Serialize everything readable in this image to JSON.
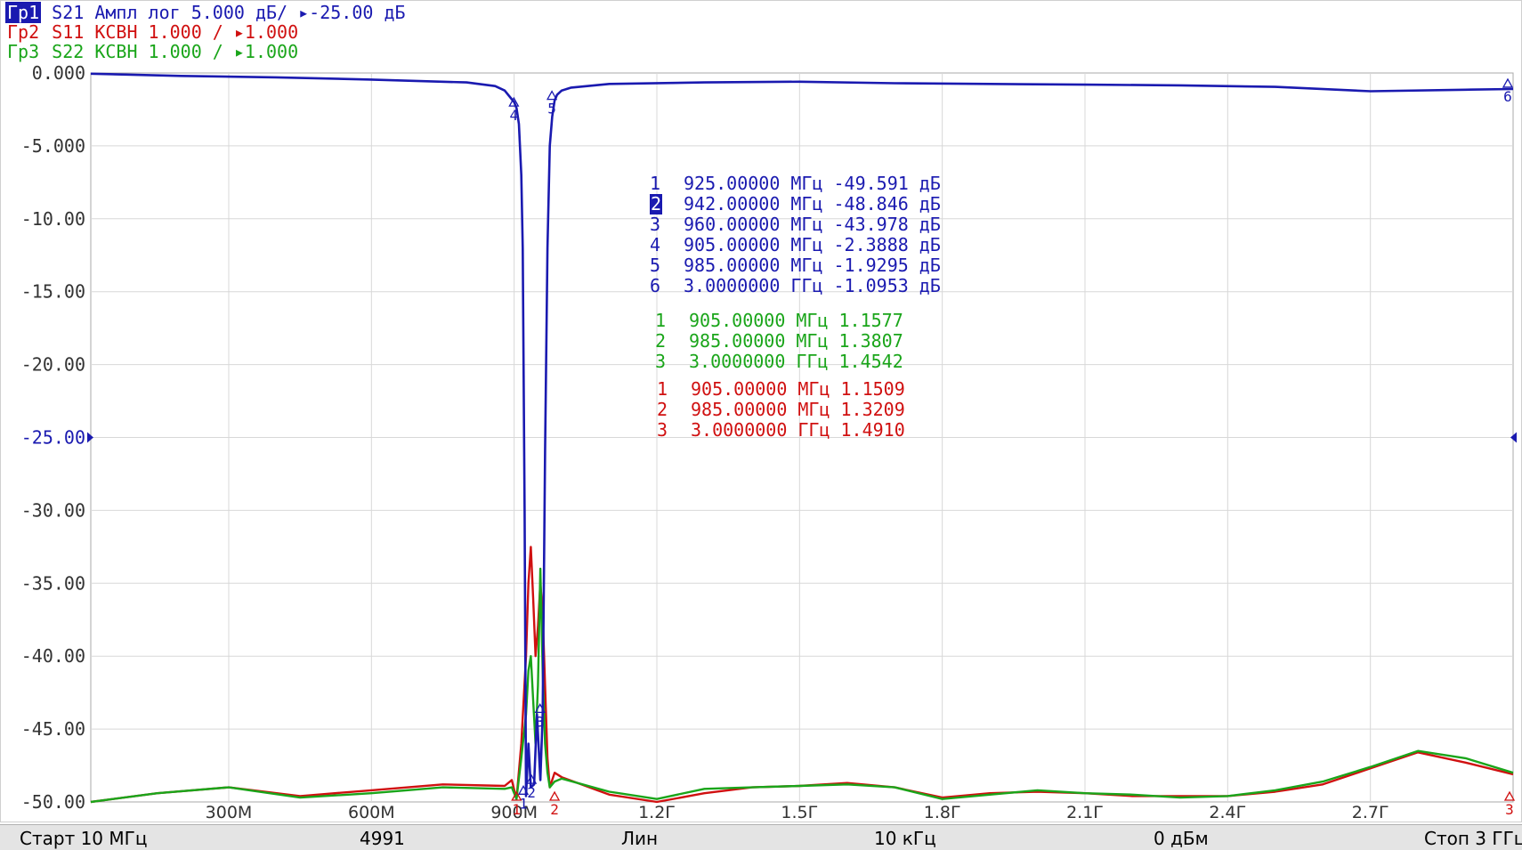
{
  "header": {
    "trace1": {
      "tag": "Гр1",
      "text": " S21 Ампл лог 5.000 дБ/ ▸-25.00 дБ"
    },
    "trace2": {
      "tag": "Гр2",
      "text": " S11 КСВН 1.000 / ▸1.000"
    },
    "trace3": {
      "tag": "Гр3",
      "text": " S22 КСВН 1.000 / ▸1.000"
    }
  },
  "colors": {
    "s21": "#1a1ab0",
    "s11": "#d01010",
    "s22": "#1aa51a",
    "grid": "#d8d8d8"
  },
  "markers": {
    "s21": [
      {
        "n": "1",
        "freq": "925.00000",
        "unit": "МГц",
        "val": "-49.591",
        "vunit": "дБ"
      },
      {
        "n": "2",
        "freq": "942.00000",
        "unit": "МГц",
        "val": "-48.846",
        "vunit": "дБ",
        "selected": true
      },
      {
        "n": "3",
        "freq": "960.00000",
        "unit": "МГц",
        "val": "-43.978",
        "vunit": "дБ"
      },
      {
        "n": "4",
        "freq": "905.00000",
        "unit": "МГц",
        "val": "-2.3888",
        "vunit": "дБ"
      },
      {
        "n": "5",
        "freq": "985.00000",
        "unit": "МГц",
        "val": "-1.9295",
        "vunit": "дБ"
      },
      {
        "n": "6",
        "freq": "3.0000000",
        "unit": "ГГц",
        "val": "-1.0953",
        "vunit": "дБ"
      }
    ],
    "s22": [
      {
        "n": "1",
        "freq": "905.00000",
        "unit": "МГц",
        "val": "1.1577",
        "vunit": ""
      },
      {
        "n": "2",
        "freq": "985.00000",
        "unit": "МГц",
        "val": "1.3807",
        "vunit": ""
      },
      {
        "n": "3",
        "freq": "3.0000000",
        "unit": "ГГц",
        "val": "1.4542",
        "vunit": ""
      }
    ],
    "s11": [
      {
        "n": "1",
        "freq": "905.00000",
        "unit": "МГц",
        "val": "1.1509",
        "vunit": ""
      },
      {
        "n": "2",
        "freq": "985.00000",
        "unit": "МГц",
        "val": "1.3209",
        "vunit": ""
      },
      {
        "n": "3",
        "freq": "3.0000000",
        "unit": "ГГц",
        "val": "1.4910",
        "vunit": ""
      }
    ]
  },
  "status": {
    "start": "Старт 10 МГц",
    "points": "4991",
    "sweep": "Лин",
    "ifbw": "10 кГц",
    "power": "0 дБм",
    "stop": "Стоп 3 ГГц"
  },
  "chart_data": {
    "type": "line",
    "title": "",
    "xlabel": "",
    "ylabel": "",
    "xlim_mhz": [
      10,
      3000
    ],
    "ylim": [
      -50,
      0
    ],
    "grid": true,
    "xticks": [
      {
        "v": 300,
        "label": "300М"
      },
      {
        "v": 600,
        "label": "600М"
      },
      {
        "v": 900,
        "label": "900М"
      },
      {
        "v": 1200,
        "label": "1.2Г"
      },
      {
        "v": 1500,
        "label": "1.5Г"
      },
      {
        "v": 1800,
        "label": "1.8Г"
      },
      {
        "v": 2100,
        "label": "2.1Г"
      },
      {
        "v": 2400,
        "label": "2.4Г"
      },
      {
        "v": 2700,
        "label": "2.7Г"
      }
    ],
    "yticks": [
      {
        "v": 0,
        "label": "0.000"
      },
      {
        "v": -5,
        "label": "-5.000"
      },
      {
        "v": -10,
        "label": "-10.00"
      },
      {
        "v": -15,
        "label": "-15.00"
      },
      {
        "v": -20,
        "label": "-20.00"
      },
      {
        "v": -25,
        "label": "-25.00"
      },
      {
        "v": -30,
        "label": "-30.00"
      },
      {
        "v": -35,
        "label": "-35.00"
      },
      {
        "v": -40,
        "label": "-40.00"
      },
      {
        "v": -45,
        "label": "-45.00"
      },
      {
        "v": -50,
        "label": "-50.00"
      }
    ],
    "reference_level": -25,
    "series": [
      {
        "key": "s21",
        "x": [
          10,
          200,
          400,
          600,
          800,
          860,
          880,
          895,
          900,
          905,
          910,
          915,
          918,
          922,
          925,
          930,
          935,
          942,
          948,
          955,
          960,
          965,
          970,
          975,
          980,
          985,
          990,
          1000,
          1020,
          1100,
          1300,
          1500,
          1700,
          1900,
          2100,
          2300,
          2500,
          2700,
          2900,
          3000
        ],
        "y": [
          -0.05,
          -0.2,
          -0.3,
          -0.45,
          -0.65,
          -0.9,
          -1.2,
          -1.8,
          -2.0,
          -2.4,
          -3.5,
          -7.0,
          -12.0,
          -30.0,
          -49.6,
          -46.0,
          -49.0,
          -48.8,
          -44.0,
          -48.5,
          -44.0,
          -26.0,
          -12.0,
          -5.0,
          -3.0,
          -1.9,
          -1.5,
          -1.2,
          -1.0,
          -0.75,
          -0.65,
          -0.6,
          -0.7,
          -0.75,
          -0.8,
          -0.85,
          -0.95,
          -1.25,
          -1.15,
          -1.1
        ]
      },
      {
        "key": "s11",
        "x": [
          10,
          150,
          300,
          450,
          600,
          750,
          880,
          895,
          905,
          915,
          925,
          930,
          935,
          940,
          945,
          950,
          955,
          960,
          965,
          970,
          975,
          985,
          1000,
          1100,
          1200,
          1300,
          1400,
          1500,
          1600,
          1700,
          1800,
          1900,
          2000,
          2100,
          2200,
          2300,
          2400,
          2500,
          2600,
          2700,
          2800,
          2900,
          3000
        ],
        "y": [
          -50.0,
          -49.4,
          -49.0,
          -49.6,
          -49.2,
          -48.8,
          -48.9,
          -48.5,
          -49.8,
          -46.0,
          -40.0,
          -35.0,
          -32.5,
          -36.0,
          -40.0,
          -38.0,
          -35.0,
          -37.0,
          -42.0,
          -47.0,
          -49.0,
          -48.0,
          -48.3,
          -49.5,
          -50.0,
          -49.4,
          -49.0,
          -48.9,
          -48.7,
          -49.0,
          -49.7,
          -49.4,
          -49.3,
          -49.4,
          -49.6,
          -49.6,
          -49.6,
          -49.3,
          -48.8,
          -47.7,
          -46.6,
          -47.3,
          -48.1
        ]
      },
      {
        "key": "s22",
        "x": [
          10,
          150,
          300,
          450,
          600,
          750,
          880,
          895,
          905,
          915,
          925,
          930,
          935,
          940,
          945,
          950,
          955,
          960,
          965,
          970,
          975,
          985,
          1000,
          1100,
          1200,
          1300,
          1400,
          1500,
          1600,
          1700,
          1800,
          1900,
          2000,
          2100,
          2200,
          2300,
          2400,
          2500,
          2600,
          2700,
          2800,
          2900,
          3000
        ],
        "y": [
          -50.0,
          -49.4,
          -49.0,
          -49.7,
          -49.4,
          -49.0,
          -49.1,
          -49.0,
          -49.8,
          -47.0,
          -44.0,
          -41.0,
          -40.0,
          -43.0,
          -46.0,
          -42.0,
          -34.0,
          -41.0,
          -46.0,
          -48.0,
          -49.0,
          -48.6,
          -48.4,
          -49.3,
          -49.8,
          -49.1,
          -49.0,
          -48.9,
          -48.8,
          -49.0,
          -49.8,
          -49.5,
          -49.2,
          -49.4,
          -49.5,
          -49.7,
          -49.6,
          -49.2,
          -48.6,
          -47.6,
          -46.5,
          -47.0,
          -48.0
        ]
      }
    ]
  }
}
